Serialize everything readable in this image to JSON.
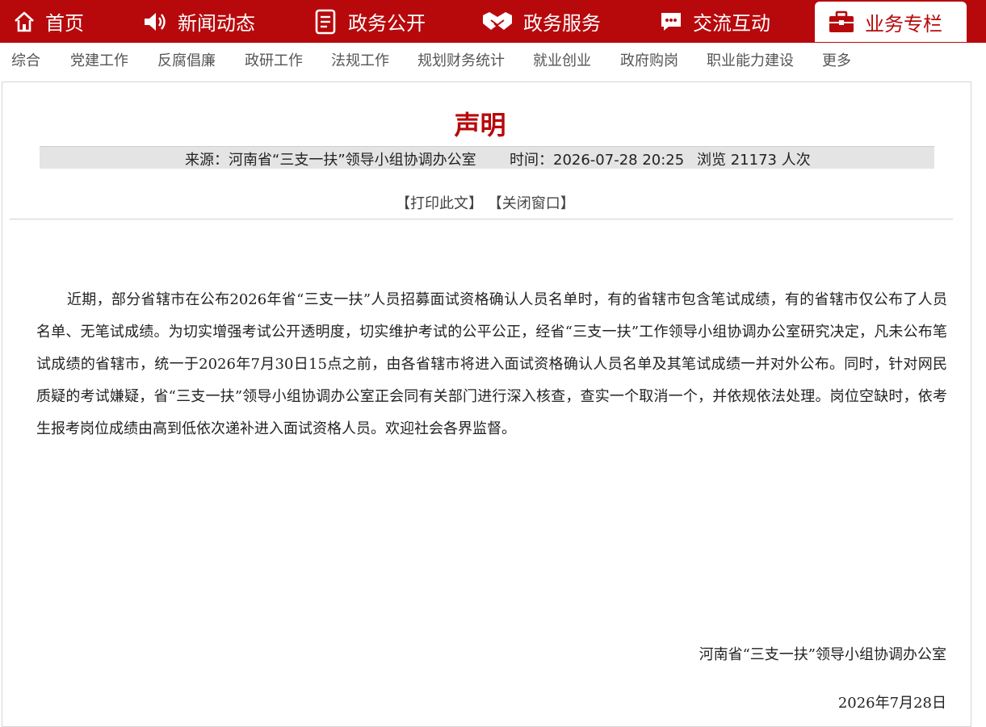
{
  "topnav": {
    "items": [
      {
        "label": "首页",
        "icon": "home-icon"
      },
      {
        "label": "新闻动态",
        "icon": "speaker-icon"
      },
      {
        "label": "政务公开",
        "icon": "document-list-icon"
      },
      {
        "label": "政务服务",
        "icon": "handshake-icon"
      },
      {
        "label": "交流互动",
        "icon": "chat-bubble-icon"
      },
      {
        "label": "业务专栏",
        "icon": "briefcase-icon",
        "active": true
      }
    ]
  },
  "subnav": {
    "items": [
      "综合",
      "党建工作",
      "反腐倡廉",
      "政研工作",
      "法规工作",
      "规划财务统计",
      "就业创业",
      "政府购岗",
      "职业能力建设",
      "更多"
    ]
  },
  "article": {
    "title": "声明",
    "source_label": "来源：",
    "source": "河南省“三支一扶”领导小组协调办公室",
    "time_label": "时间：",
    "time": "2026-07-28 20:25",
    "views_label": "浏览",
    "views": "21173",
    "views_unit": "人次",
    "print_label": "【打印此文】",
    "close_label": "【关闭窗口】",
    "body": "近期，部分省辖市在公布2026年省“三支一扶”人员招募面试资格确认人员名单时，有的省辖市包含笔试成绩，有的省辖市仅公布了人员名单、无笔试成绩。为切实增强考试公开透明度，切实维护考试的公平公正，经省“三支一扶”工作领导小组协调办公室研究决定，凡未公布笔试成绩的省辖市，统一于2026年7月30日15点之前，由各省辖市将进入面试资格确认人员名单及其笔试成绩一并对外公布。同时，针对网民质疑的考试嫌疑，省“三支一扶”领导小组协调办公室正会同有关部门进行深入核查，查实一个取消一个，并依规依法处理。岗位空缺时，依考生报考岗位成绩由高到低依次递补进入面试资格人员。欢迎社会各界监督。",
    "signer": "河南省“三支一扶”领导小组协调办公室",
    "date": "2026年7月28日"
  },
  "colors": {
    "brand_red": "#b7090c",
    "meta_bar_bg": "#e4e4e4"
  }
}
